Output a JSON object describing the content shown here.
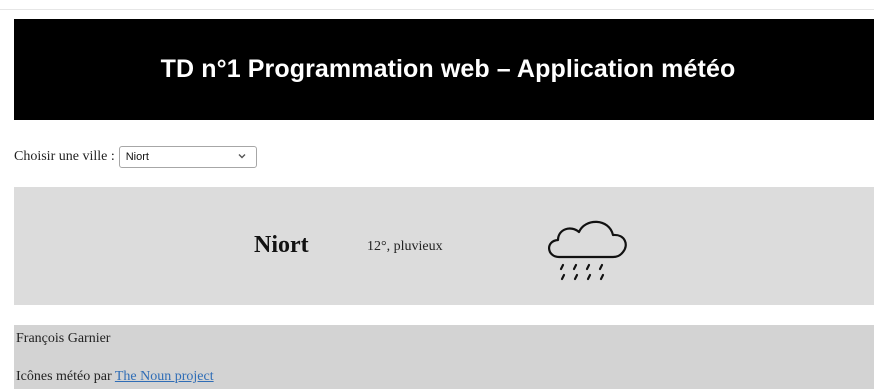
{
  "header": {
    "title": "TD n°1 Programmation web – Application météo"
  },
  "city_selector": {
    "label": "Choisir une ville :",
    "selected": "Niort"
  },
  "weather": {
    "city": "Niort",
    "description": "12°, pluvieux",
    "icon": "rain-cloud-icon"
  },
  "footer": {
    "author": "François Garnier",
    "credits_prefix": "Icônes météo par ",
    "credits_link": "The Noun project"
  },
  "colors": {
    "banner_bg": "#000000",
    "banner_text": "#ffffff",
    "panel_bg": "#dcdcdc",
    "footer_bg": "#d3d3d3",
    "link": "#2f6db6"
  }
}
